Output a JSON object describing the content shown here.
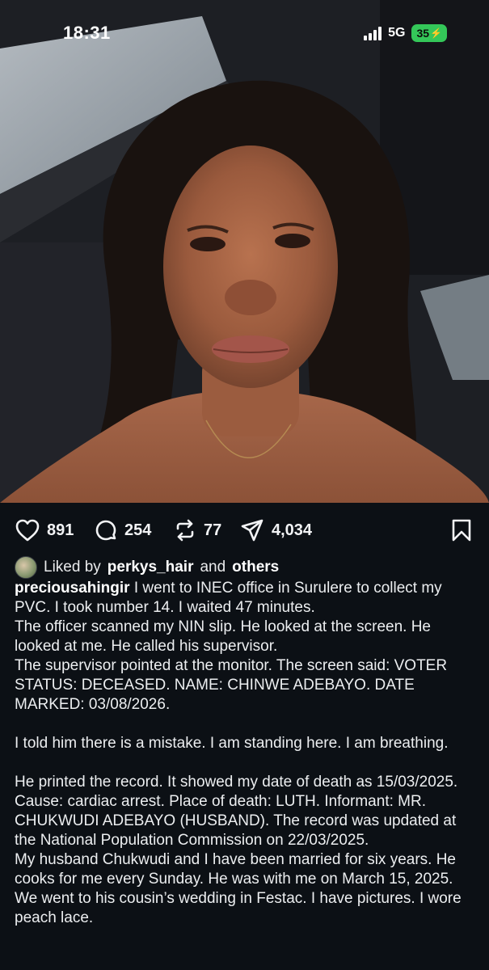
{
  "status_bar": {
    "time": "18:31",
    "network": "5G",
    "battery": "35"
  },
  "post": {
    "likes_count": "891",
    "comments_count": "254",
    "reposts_count": "77",
    "shares_count": "4,034",
    "liked_by_prefix": "Liked by",
    "liked_by_user": "perkys_hair",
    "liked_by_and": "and",
    "liked_by_others": "others",
    "username": "preciousahingir",
    "caption_paragraphs": [
      "I went to INEC office in Surulere to collect my PVC. I took number 14. I waited 47 minutes.",
      "The officer scanned my NIN slip. He looked at the screen. He looked at me. He called his supervisor.",
      "The supervisor pointed at the monitor. The screen said: VOTER STATUS: DECEASED. NAME: CHINWE ADEBAYO. DATE MARKED: 03/08/2026.",
      "I told him there is a mistake. I am standing here. I am breathing.",
      "He printed the record. It showed my date of death as 15/03/2025. Cause: cardiac arrest. Place of death: LUTH. Informant: MR. CHUKWUDI ADEBAYO (HUSBAND). The record was updated at the National Population Commission on 22/03/2025.",
      "My husband Chukwudi and I have been married for six years. He cooks for me every Sunday. He was with me on March 15, 2025. We went to his cousin’s wedding in Festac. I have pictures. I wore peach lace."
    ]
  },
  "icons": {
    "like": "heart-icon",
    "comment": "comment-bubble-icon",
    "repost": "repost-arrows-icon",
    "share": "send-icon",
    "save": "bookmark-icon"
  },
  "colors": {
    "background": "#0c1015",
    "battery_green": "#34c759",
    "text": "#f2f3f5"
  }
}
